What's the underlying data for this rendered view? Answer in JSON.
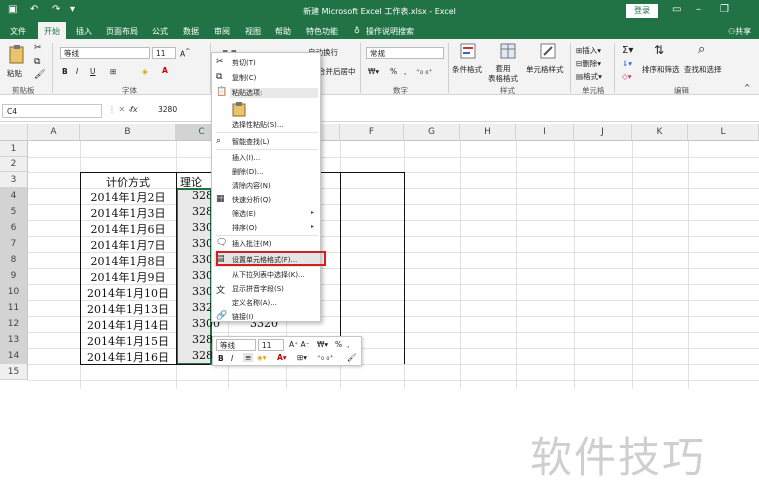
{
  "titlebar": {
    "title": "新建 Microsoft Excel 工作表.xlsx - Excel",
    "login": "登录",
    "bg": "#217346"
  },
  "tabs": [
    "文件",
    "开始",
    "插入",
    "页面布局",
    "公式",
    "数据",
    "审阅",
    "视图",
    "帮助",
    "特色功能",
    "操作说明搜索"
  ],
  "share": "共享",
  "ribbon": {
    "paste": "粘贴",
    "clipboard": "剪贴板",
    "font_name": "等线",
    "font_size": "11",
    "font_group": "字体",
    "wrap": "自动换行",
    "merge": "合并后居中",
    "number_format": "常规",
    "number_group": "数字",
    "cond_format": "条件格式",
    "table_format": "套用\n表格格式",
    "cell_style": "单元格样式",
    "styles_group": "样式",
    "insert": "插入",
    "delete": "删除",
    "format": "格式",
    "cells_group": "单元格",
    "sort": "排序和筛选",
    "find": "查找和选择",
    "edit_group": "编辑",
    "bold": "B",
    "italic": "I",
    "underline": "U",
    "percent": "%",
    "comma": ","
  },
  "formula": {
    "namebox": "C4",
    "fx": "fx",
    "value": "3280"
  },
  "columns": [
    "A",
    "B",
    "C",
    "D",
    "E",
    "F",
    "G",
    "H",
    "I",
    "J",
    "K",
    "L"
  ],
  "rows": [
    "1",
    "2",
    "3",
    "4",
    "5",
    "6",
    "7",
    "8",
    "9",
    "10",
    "11",
    "12",
    "13",
    "14",
    "15"
  ],
  "table": {
    "header_b": "计价方式",
    "header_c": "理论",
    "dates": [
      "2014年1月2日",
      "2014年1月3日",
      "2014年1月6日",
      "2014年1月7日",
      "2014年1月8日",
      "2014年1月9日",
      "2014年1月10日",
      "2014年1月13日",
      "2014年1月14日",
      "2014年1月15日",
      "2014年1月16日"
    ],
    "values": [
      "328",
      "328",
      "330",
      "330",
      "330",
      "330",
      "330",
      "332",
      "3300",
      "328",
      "328"
    ],
    "d_partial": "3320"
  },
  "context_menu": {
    "items": [
      "剪切(T)",
      "复制(C)",
      "粘贴选项:",
      "",
      "选择性粘贴(S)...",
      "智能查找(L)",
      "插入(I)...",
      "删除(D)...",
      "清除内容(N)",
      "快速分析(Q)",
      "筛选(E)",
      "排序(O)",
      "插入批注(M)",
      "设置单元格格式(F)...",
      "从下拉列表中选择(K)...",
      "显示拼音字段(S)",
      "定义名称(A)...",
      "链接(I)"
    ],
    "highlight_color": "#d02020"
  },
  "mini_toolbar": {
    "font": "等线",
    "size": "11",
    "bold": "B",
    "italic": "I",
    "percent": "%",
    "comma": ","
  },
  "watermark": "软件技巧"
}
